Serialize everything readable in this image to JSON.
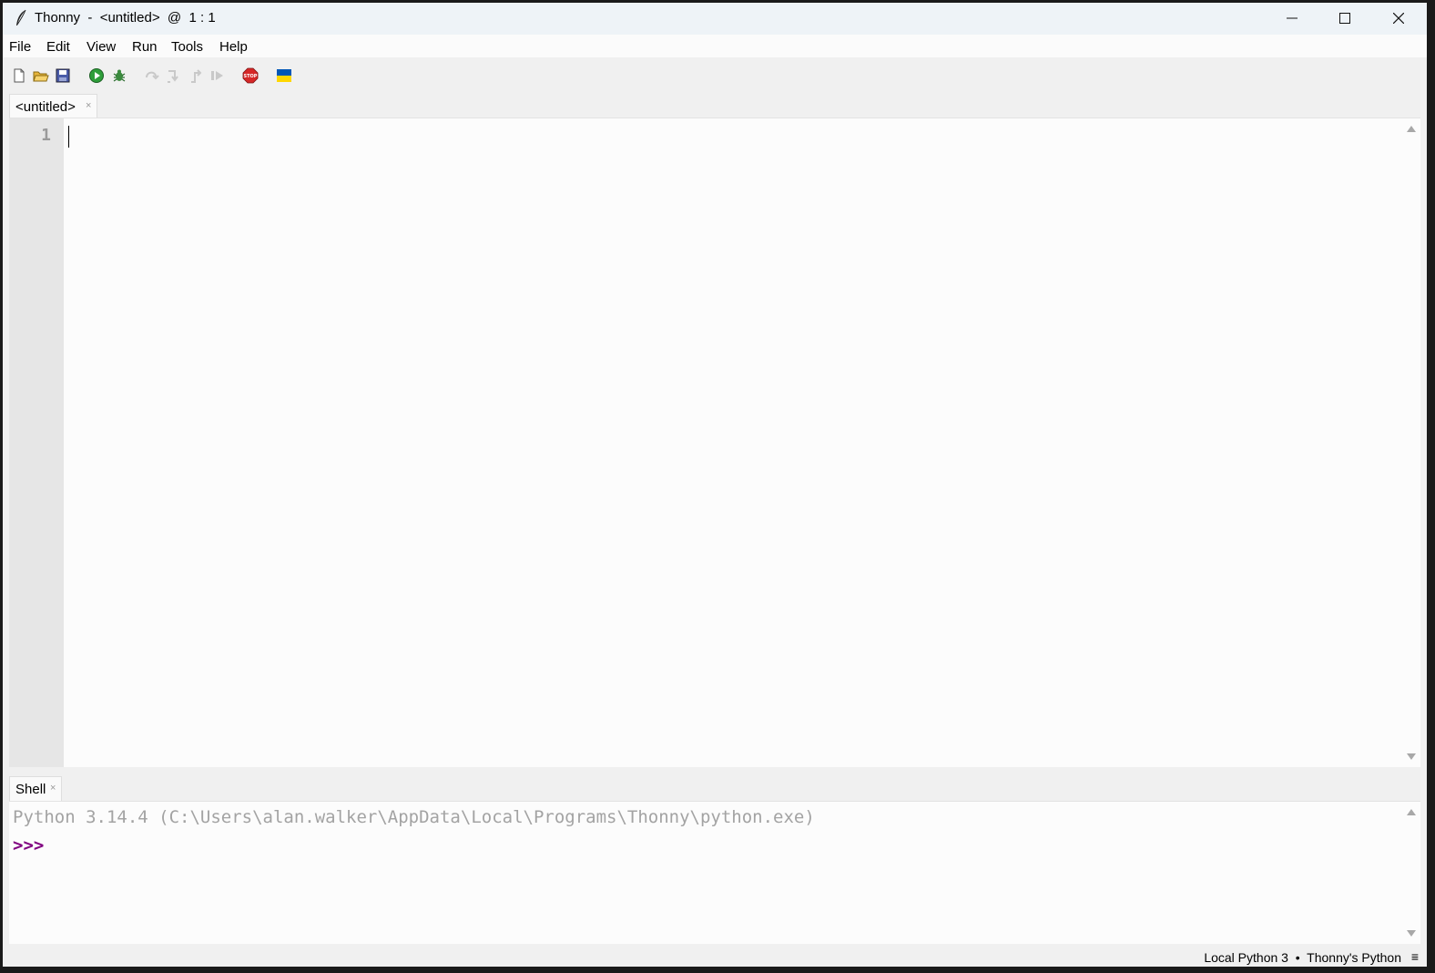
{
  "window": {
    "title": "Thonny  -  <untitled>  @  1 : 1"
  },
  "menu": {
    "items": [
      "File",
      "Edit",
      "View",
      "Run",
      "Tools",
      "Help"
    ]
  },
  "toolbar": {
    "icons": [
      "new-file-icon",
      "open-folder-icon",
      "save-icon",
      "run-icon",
      "debug-bug-icon",
      "step-over-icon",
      "step-into-icon",
      "step-out-icon",
      "resume-icon",
      "stop-icon",
      "ukraine-flag-icon"
    ],
    "colors": {
      "run": "#2e9e3a",
      "stop": "#d62828",
      "flag_blue": "#0057b7",
      "flag_yellow": "#ffd700"
    }
  },
  "editor": {
    "tab_label": "<untitled>",
    "tab_close": "×",
    "line_numbers": [
      "1"
    ]
  },
  "shell": {
    "tab_label": "Shell",
    "tab_close": "×",
    "banner": "Python 3.14.4 (C:\\Users\\alan.walker\\AppData\\Local\\Programs\\Thonny\\python.exe)",
    "prompt": ">>>",
    "prompt_color": "#800080"
  },
  "status": {
    "interpreter": "Local Python 3  •  Thonny's Python",
    "menu_glyph": "≡"
  }
}
